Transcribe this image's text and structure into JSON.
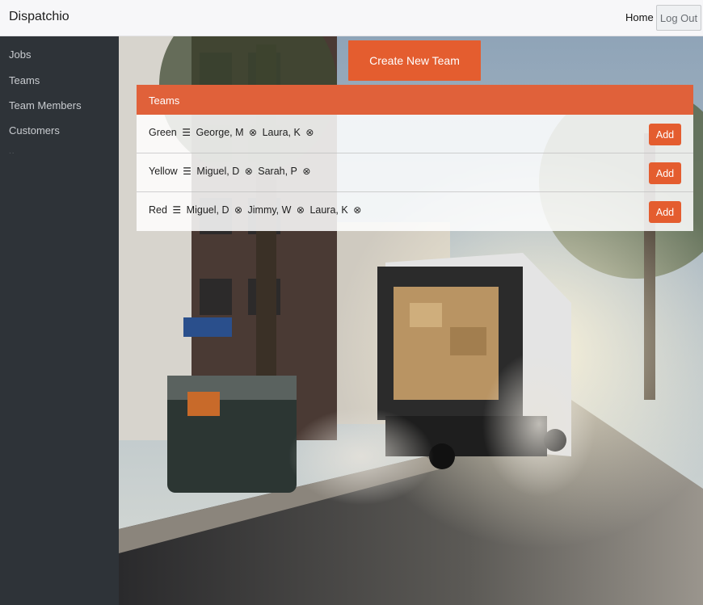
{
  "navbar": {
    "brand": "Dispatchio",
    "home": "Home",
    "logout": "Log Out"
  },
  "sidebar": {
    "items": [
      {
        "label": "Jobs"
      },
      {
        "label": "Teams"
      },
      {
        "label": "Team Members"
      },
      {
        "label": "Customers"
      }
    ],
    "extra": ".."
  },
  "create_button": "Create New Team",
  "teams_panel": {
    "title": "Teams",
    "rows": [
      {
        "name": "Green",
        "menu_icon": "☰",
        "members": [
          "George, M",
          "Laura, K"
        ],
        "remove_icon": "⊗",
        "add_label": "Add"
      },
      {
        "name": "Yellow",
        "menu_icon": "☰",
        "members": [
          "Miguel, D",
          "Sarah, P"
        ],
        "remove_icon": "⊗",
        "add_label": "Add"
      },
      {
        "name": "Red",
        "menu_icon": "☰",
        "members": [
          "Miguel, D",
          "Jimmy, W",
          "Laura, K"
        ],
        "remove_icon": "⊗",
        "add_label": "Add"
      }
    ]
  },
  "colors": {
    "accent": "#e45d2f",
    "panel_header": "#e0613a",
    "sidebar": "#2e3338",
    "navbar": "#f7f7f9"
  },
  "background": {
    "icons": [
      "truck-image",
      "street-image"
    ]
  }
}
